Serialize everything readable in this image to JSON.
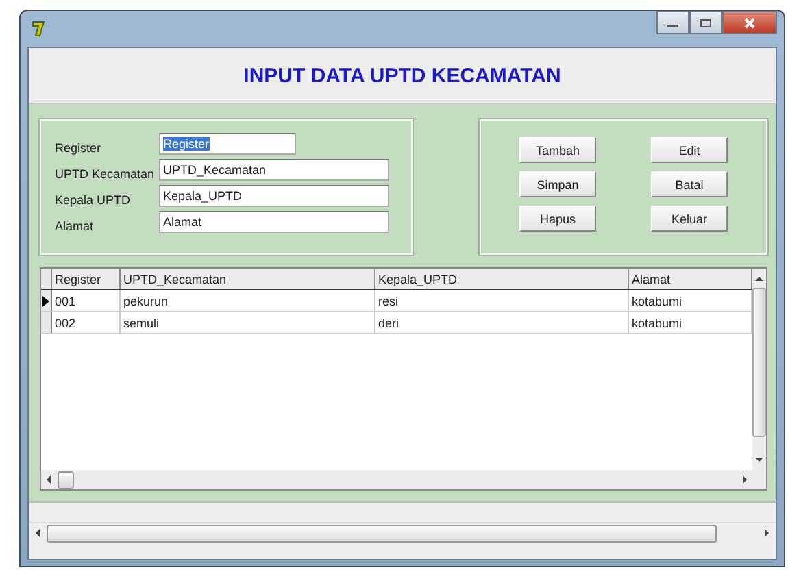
{
  "window": {
    "heading": "INPUT DATA UPTD KECAMATAN"
  },
  "form": {
    "fields": [
      {
        "label": "Register",
        "value": "Register",
        "highlighted": true
      },
      {
        "label": "UPTD Kecamatan",
        "value": "UPTD_Kecamatan",
        "highlighted": false
      },
      {
        "label": "Kepala UPTD",
        "value": "Kepala_UPTD",
        "highlighted": false
      },
      {
        "label": "Alamat",
        "value": "Alamat",
        "highlighted": false
      }
    ]
  },
  "buttons": [
    {
      "label": "Tambah"
    },
    {
      "label": "Edit"
    },
    {
      "label": "Simpan"
    },
    {
      "label": "Batal"
    },
    {
      "label": "Hapus"
    },
    {
      "label": "Keluar"
    }
  ],
  "table": {
    "columns": [
      "Register",
      "UPTD_Kecamatan",
      "Kepala_UPTD",
      "Alamat"
    ],
    "rows": [
      {
        "cells": [
          "001",
          "pekurun",
          "resi",
          "kotabumi"
        ],
        "selected": true
      },
      {
        "cells": [
          "002",
          "semuli",
          "deri",
          "kotabumi"
        ],
        "selected": false
      }
    ]
  }
}
